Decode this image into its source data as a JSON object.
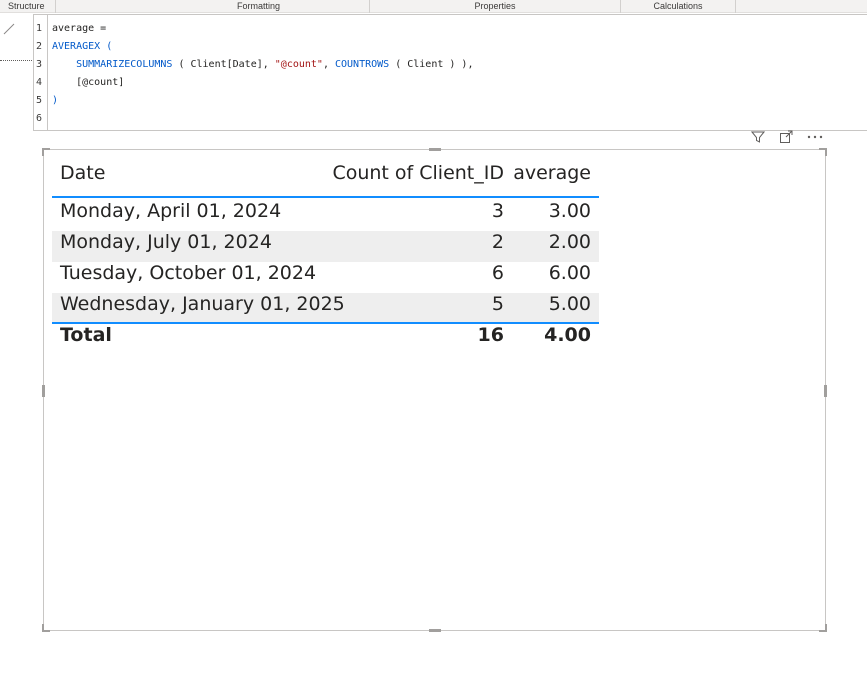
{
  "ribbon": {
    "groups": [
      "Structure",
      "Formatting",
      "Properties",
      "Calculations"
    ]
  },
  "formula": {
    "line_numbers": [
      "1",
      "2",
      "3",
      "4",
      "5",
      "6"
    ],
    "line1": "average =",
    "line2_fn": "AVERAGEX",
    "line2_paren": " (",
    "line3_fn": "SUMMARIZECOLUMNS",
    "line3_a": " ( Client[Date], ",
    "line3_str": "\"@count\"",
    "line3_b": ", ",
    "line3_fn2": "COUNTROWS",
    "line3_c": " ( Client ) ),",
    "line4": "[@count]",
    "line5": ")"
  },
  "visual_header": {
    "icons": [
      "filter-icon",
      "focus-mode-icon",
      "more-options-icon"
    ]
  },
  "table": {
    "columns": [
      "Date",
      "Count of Client_ID",
      "average"
    ],
    "rows": [
      {
        "date": "Monday, April 01, 2024",
        "count": "3",
        "average": "3.00"
      },
      {
        "date": "Monday, July 01, 2024",
        "count": "2",
        "average": "2.00"
      },
      {
        "date": "Tuesday, October 01, 2024",
        "count": "6",
        "average": "6.00"
      },
      {
        "date": "Wednesday, January 01, 2025",
        "count": "5",
        "average": "5.00"
      }
    ],
    "total": {
      "label": "Total",
      "count": "16",
      "average": "4.00"
    },
    "accent_color": "#118dff",
    "alt_row_color": "#eeeeee"
  }
}
